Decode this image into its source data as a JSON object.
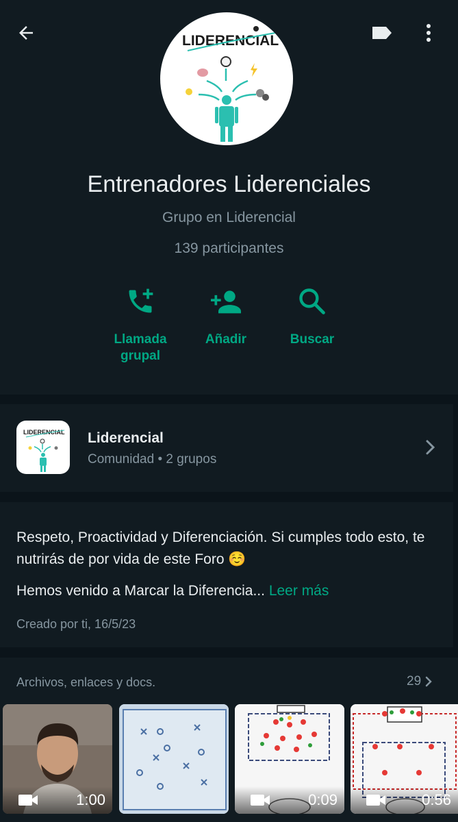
{
  "header": {
    "icons": {
      "back": "arrow-left-icon",
      "label": "label-tag-icon",
      "more": "more-vertical-icon"
    }
  },
  "group": {
    "logo_text": "LIDERENCIAL",
    "name": "Entrenadores Liderenciales",
    "subtitle": "Grupo en Liderencial",
    "participants": "139 participantes"
  },
  "actions": [
    {
      "label": "Llamada grupal",
      "line1": "Llamada",
      "line2": "grupal",
      "icon": "phone-plus-icon"
    },
    {
      "label": "Añadir",
      "icon": "person-add-icon"
    },
    {
      "label": "Buscar",
      "icon": "search-icon"
    }
  ],
  "community": {
    "logo_text": "LIDERENCIAL",
    "name": "Liderencial",
    "meta": "Comunidad • 2 grupos"
  },
  "description": {
    "text": "Respeto, Proactividad y Diferenciación. Si cumples todo esto, te nutrirás de por vida de este Foro ☺️",
    "text2": "Hemos venido a Marcar la Diferencia...",
    "read_more": "Leer más",
    "created": "Creado por ti, 16/5/23"
  },
  "media": {
    "title": "Archivos, enlaces y docs.",
    "count": "29",
    "items": [
      {
        "type": "video",
        "duration": "1:00",
        "icon": "video-camera-icon"
      },
      {
        "type": "image"
      },
      {
        "type": "video",
        "duration": "0:09",
        "icon": "video-camera-icon"
      },
      {
        "type": "video",
        "duration": "0:56",
        "icon": "video-camera-icon"
      }
    ]
  },
  "colors": {
    "background": "#0b141a",
    "panel": "#111b21",
    "accent": "#00a884",
    "secondary_text": "#8696a0",
    "primary_text": "#e9edef"
  }
}
